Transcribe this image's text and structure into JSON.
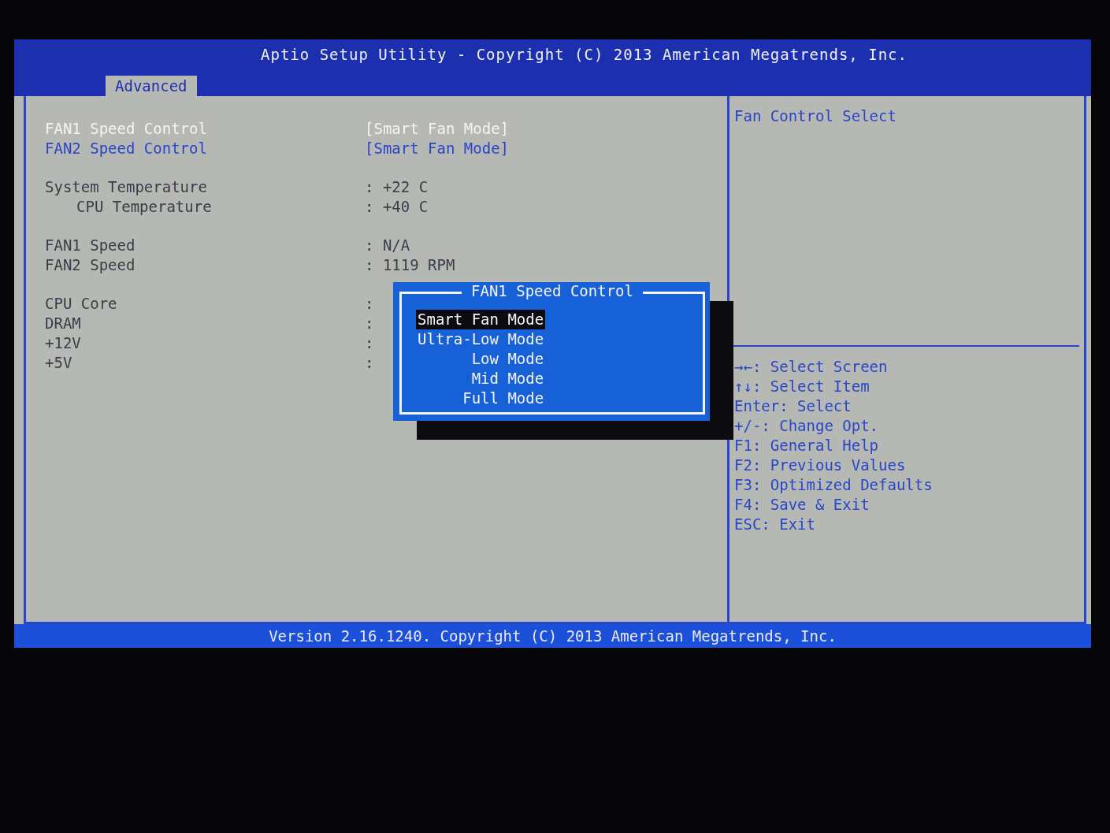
{
  "header": {
    "title": "Aptio Setup Utility - Copyright (C) 2013 American Megatrends, Inc.",
    "tabs": [
      {
        "label": "Advanced",
        "selected": true
      }
    ]
  },
  "setting_groups": [
    {
      "items": [
        {
          "kind": "option",
          "label": "FAN1 Speed Control",
          "value": "[Smart Fan Mode]",
          "selected": true,
          "indented": false
        },
        {
          "kind": "option",
          "label": "FAN2 Speed Control",
          "value": "[Smart Fan Mode]",
          "selected": false,
          "indented": false
        }
      ]
    },
    {
      "items": [
        {
          "kind": "info",
          "label": "System Temperature",
          "value": ": +22 C",
          "selected": false,
          "indented": false
        },
        {
          "kind": "info",
          "label": "CPU Temperature",
          "value": ": +40 C",
          "selected": false,
          "indented": true
        }
      ]
    },
    {
      "items": [
        {
          "kind": "info",
          "label": "FAN1 Speed",
          "value": ": N/A",
          "selected": false,
          "indented": false
        },
        {
          "kind": "info",
          "label": "FAN2 Speed",
          "value": ": 1119 RPM",
          "selected": false,
          "indented": false
        }
      ]
    },
    {
      "items": [
        {
          "kind": "info",
          "label": "CPU Core",
          "value": ":",
          "selected": false,
          "indented": false
        },
        {
          "kind": "info",
          "label": "DRAM",
          "value": ":",
          "selected": false,
          "indented": false
        },
        {
          "kind": "info",
          "label": "+12V",
          "value": ":",
          "selected": false,
          "indented": false
        },
        {
          "kind": "info",
          "label": "+5V",
          "value": ":",
          "selected": false,
          "indented": false
        }
      ]
    }
  ],
  "popup": {
    "title": "FAN1 Speed Control",
    "options": [
      {
        "label": "Smart Fan Mode",
        "selected": true
      },
      {
        "label": "Ultra-Low Mode",
        "selected": false
      },
      {
        "label": "Low Mode",
        "selected": false
      },
      {
        "label": "Mid Mode",
        "selected": false
      },
      {
        "label": "Full Mode",
        "selected": false
      }
    ]
  },
  "help": {
    "description": "Fan Control Select",
    "keys": [
      "→←: Select Screen",
      "↑↓: Select Item",
      "Enter: Select",
      "+/-: Change Opt.",
      "F1: General Help",
      "F2: Previous Values",
      "F3: Optimized Defaults",
      "F4: Save & Exit",
      "ESC: Exit"
    ]
  },
  "footer": "Version 2.16.1240. Copyright (C) 2013 American Megatrends, Inc."
}
